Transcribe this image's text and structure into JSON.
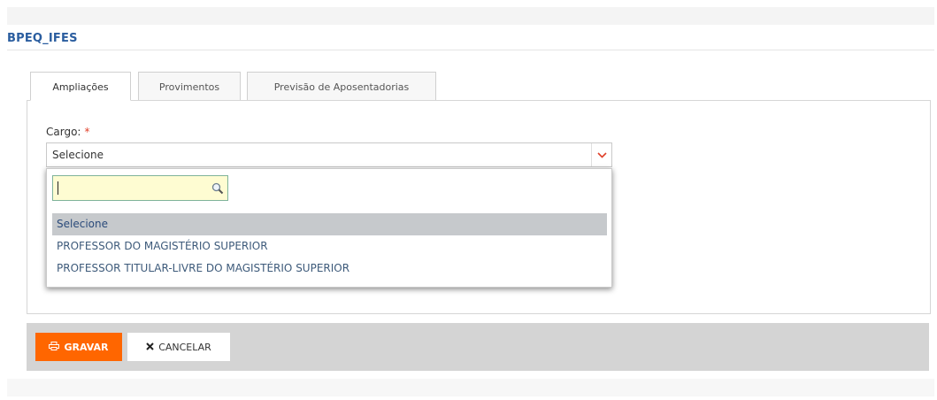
{
  "header": {
    "title": "BPEQ_IFES"
  },
  "tabs": [
    {
      "label": "Ampliações",
      "active": true
    },
    {
      "label": "Provimentos",
      "active": false
    },
    {
      "label": "Previsão de Aposentadorias",
      "active": false
    }
  ],
  "form": {
    "cargo_label": "Cargo:",
    "required_mark": "*",
    "cargo_value": "Selecione",
    "dropdown": {
      "search_value": "",
      "options": [
        "Selecione",
        "PROFESSOR DO MAGISTÉRIO SUPERIOR",
        "PROFESSOR TITULAR-LIVRE DO MAGISTÉRIO SUPERIOR"
      ],
      "selected_index": 0
    }
  },
  "actions": {
    "save_label": "GRAVAR",
    "save_icon": "printer-icon",
    "cancel_label": "CANCELAR",
    "cancel_icon": "close-icon"
  },
  "colors": {
    "accent": "#ff6600",
    "title": "#2a5d9f",
    "required": "#e0402a",
    "search_bg": "#fefcd2"
  }
}
